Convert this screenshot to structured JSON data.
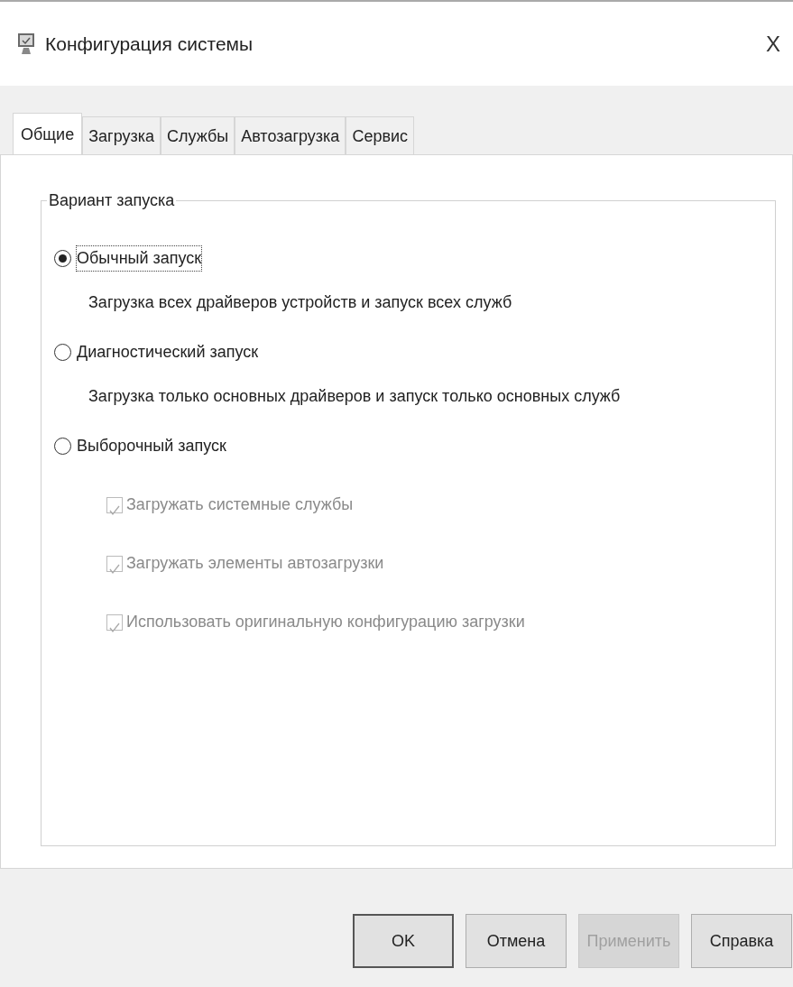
{
  "window": {
    "title": "Конфигурация системы",
    "close": "X"
  },
  "tabs": [
    {
      "label": "Общие",
      "selected": true
    },
    {
      "label": "Загрузка",
      "selected": false
    },
    {
      "label": "Службы",
      "selected": false
    },
    {
      "label": "Автозагрузка",
      "selected": false
    },
    {
      "label": "Сервис",
      "selected": false
    }
  ],
  "group": {
    "legend": "Вариант запуска",
    "options": [
      {
        "kind": "radio",
        "label": "Обычный запуск",
        "selected": true,
        "focused": true,
        "description": "Загрузка всех драйверов устройств и запуск всех служб"
      },
      {
        "kind": "radio",
        "label": "Диагностический запуск",
        "selected": false,
        "focused": false,
        "description": "Загрузка только основных драйверов и запуск только основных служб"
      },
      {
        "kind": "radio",
        "label": "Выборочный запуск",
        "selected": false,
        "focused": false,
        "children": [
          {
            "kind": "checkbox",
            "label": "Загружать системные службы",
            "checked": true,
            "disabled": true
          },
          {
            "kind": "checkbox",
            "label": "Загружать элементы автозагрузки",
            "checked": true,
            "disabled": true
          },
          {
            "kind": "checkbox",
            "label": "Использовать оригинальную конфигурацию загрузки",
            "checked": true,
            "disabled": true
          }
        ]
      }
    ]
  },
  "buttons": [
    {
      "label": "OK",
      "default": true,
      "disabled": false
    },
    {
      "label": "Отмена",
      "default": false,
      "disabled": false
    },
    {
      "label": "Применить",
      "default": false,
      "disabled": true
    },
    {
      "label": "Справка",
      "default": false,
      "disabled": false
    }
  ]
}
